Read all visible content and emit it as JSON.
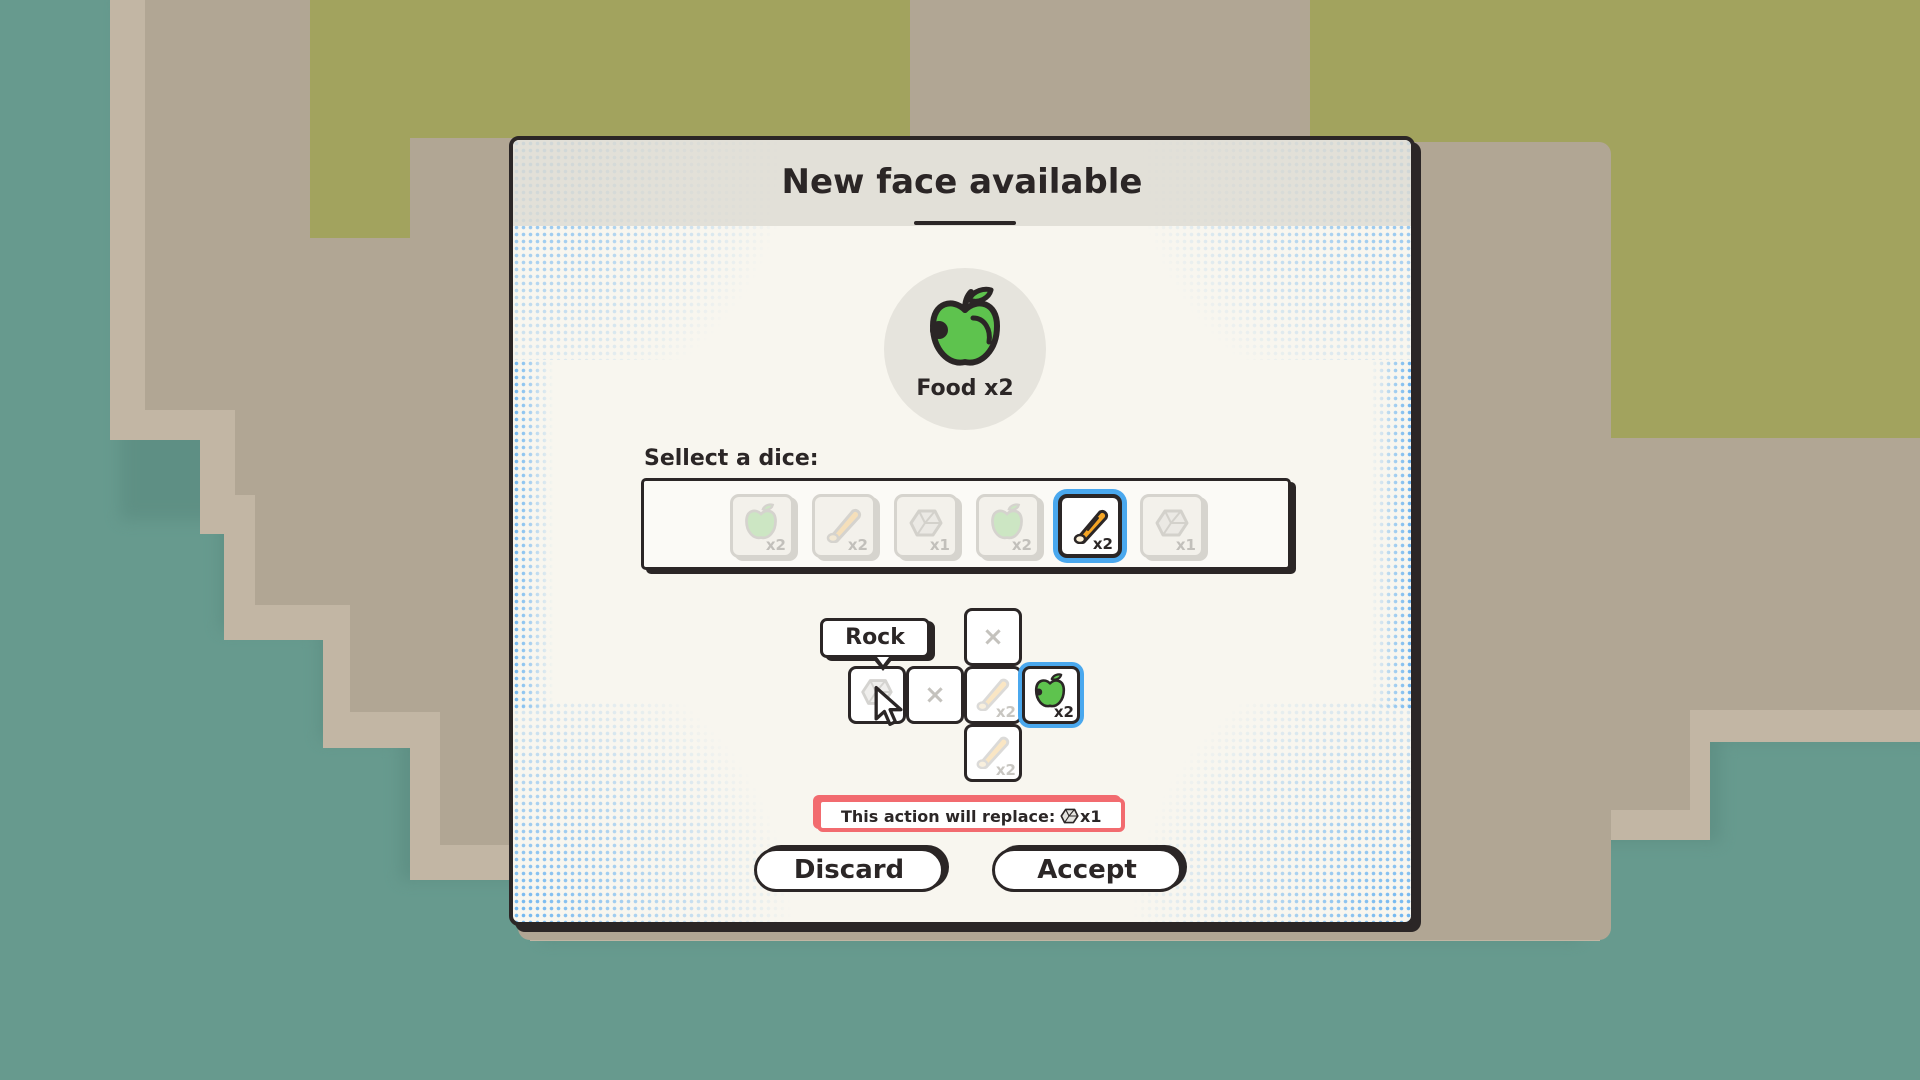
{
  "modal": {
    "title": "New face available",
    "new_face": {
      "icon": "apple-icon",
      "label": "Food x2"
    },
    "select_label": "Sellect a dice:",
    "dice": [
      {
        "icon": "apple-icon",
        "count": "x2",
        "selected": false
      },
      {
        "icon": "log-icon",
        "count": "x2",
        "selected": false
      },
      {
        "icon": "rock-icon",
        "count": "x1",
        "selected": false
      },
      {
        "icon": "apple-icon",
        "count": "x2",
        "selected": false
      },
      {
        "icon": "log-icon",
        "count": "x2",
        "selected": true
      },
      {
        "icon": "rock-icon",
        "count": "x1",
        "selected": false
      }
    ],
    "die_net": {
      "tooltip": "Rock",
      "faces": [
        {
          "icon": "x-icon",
          "mark": "×"
        },
        {
          "icon": "rock-icon",
          "count": ""
        },
        {
          "icon": "x-icon",
          "mark": "×"
        },
        {
          "icon": "log-icon",
          "count": "x2"
        },
        {
          "icon": "apple-icon",
          "count": "x2",
          "highlighted": true
        },
        {
          "icon": "log-icon",
          "count": "x2"
        }
      ]
    },
    "warning": {
      "text": "This action will replace:",
      "icon": "rock-icon",
      "count": "x1"
    },
    "buttons": {
      "discard": "Discard",
      "accept": "Accept"
    }
  },
  "colors": {
    "water": "#679a8e",
    "sand": "#b1a694",
    "grass": "#a2a35e",
    "ink": "#2b2626",
    "panel": "#f8f6ef",
    "select_blue": "#4aa8ee",
    "warning_red": "#f26b6f",
    "apple_green": "#5ec34e",
    "log_orange": "#f5a524"
  }
}
